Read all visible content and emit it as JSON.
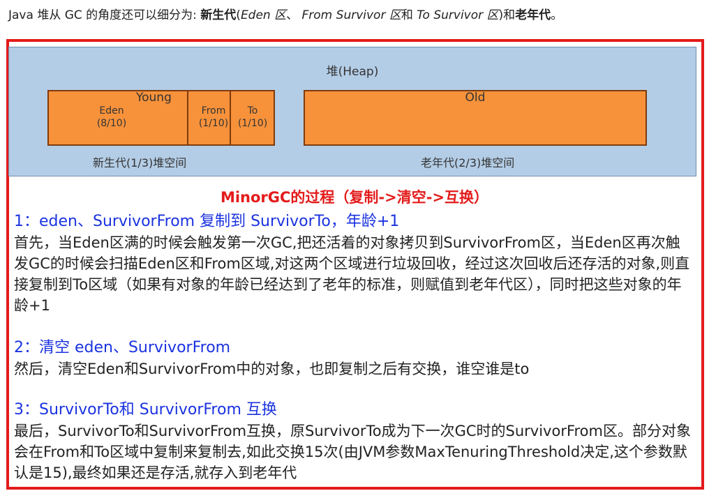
{
  "intro": {
    "prefix": "Java 堆从 GC 的角度还可以细分为: ",
    "young_gen": "新生代",
    "paren_open": "(",
    "eden": "Eden 区",
    "sep1": "、 ",
    "from": "From Survivor 区",
    "and": "和 ",
    "to": "To Survivor 区",
    "paren_close": ")和",
    "old_gen": "老年代",
    "end": "。"
  },
  "diagram": {
    "heap_title": "堆(Heap)",
    "young_label": "Young",
    "eden_name": "Eden",
    "eden_ratio": "(8/10)",
    "from_name": "From",
    "from_ratio": "(1/10)",
    "to_name": "To",
    "to_ratio": "(1/10)",
    "old_label": "Old",
    "young_caption": "新生代(1/3)堆空间",
    "old_caption": "老年代(2/3)堆空间"
  },
  "title": "MinorGC的过程（复制->清空->互换）",
  "steps": [
    {
      "heading": "1：eden、SurvivorFrom 复制到 SurvivorTo，年龄+1",
      "body": "首先，当Eden区满的时候会触发第一次GC,把还活着的对象拷贝到SurvivorFrom区，当Eden区再次触发GC的时候会扫描Eden区和From区域,对这两个区域进行垃圾回收，经过这次回收后还存活的对象,则直接复制到To区域（如果有对象的年龄已经达到了老年的标准，则赋值到老年代区），同时把这些对象的年龄+1"
    },
    {
      "heading": "2：清空 eden、SurvivorFrom",
      "body": "然后，清空Eden和SurvivorFrom中的对象，也即复制之后有交换，谁空谁是to"
    },
    {
      "heading": "3：SurvivorTo和 SurvivorFrom 互换",
      "body": "最后，SurvivorTo和SurvivorFrom互换，原SurvivorTo成为下一次GC时的SurvivorFrom区。部分对象会在From和To区域中复制来复制去,如此交换15次(由JVM参数MaxTenuringThreshold决定,这个参数默认是15),最终如果还是存活,就存入到老年代"
    }
  ],
  "colors": {
    "frame": "#e41b1b",
    "heap_bg": "#b4cde6",
    "region_fill": "#f7923b",
    "heading": "#1a32e0",
    "title": "#e41b1b"
  }
}
